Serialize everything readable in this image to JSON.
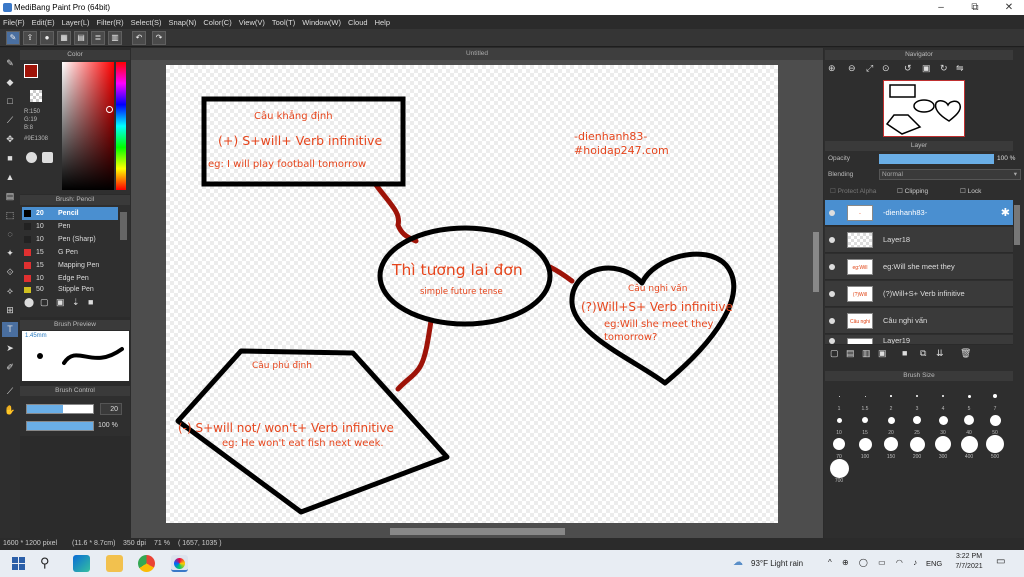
{
  "window": {
    "title": "MediBang Paint Pro (64bit)",
    "minimize": "–",
    "restore": "⧉",
    "close": "✕"
  },
  "menu": [
    "File(F)",
    "Edit(E)",
    "Layer(L)",
    "Filter(R)",
    "Select(S)",
    "Snap(N)",
    "Color(C)",
    "View(V)",
    "Tool(T)",
    "Window(W)",
    "Cloud",
    "Help"
  ],
  "color_panel": {
    "title": "Color",
    "r": "R:150",
    "g": "G:19",
    "b": "B:8",
    "hex": "#9E1308",
    "primary": "#9e1308"
  },
  "brush_panel": {
    "title": "Brush: Pencil",
    "items": [
      {
        "size": "20",
        "name": "Pencil",
        "color": "#4a8fd0",
        "selected": true
      },
      {
        "size": "10",
        "name": "Pen",
        "color": "#222222",
        "selected": false
      },
      {
        "size": "10",
        "name": "Pen (Sharp)",
        "color": "#222222",
        "selected": false
      },
      {
        "size": "15",
        "name": "G Pen",
        "color": "#e03030",
        "selected": false
      },
      {
        "size": "15",
        "name": "Mapping Pen",
        "color": "#e03030",
        "selected": false
      },
      {
        "size": "10",
        "name": "Edge Pen",
        "color": "#e03030",
        "selected": false
      },
      {
        "size": "50",
        "name": "Stipple Pen",
        "color": "#d0c020",
        "selected": false
      }
    ]
  },
  "brush_preview": {
    "title": "Brush Preview",
    "size": "1.45mm"
  },
  "brush_control": {
    "title": "Brush Control",
    "size": "20",
    "opacity": "100 %",
    "size_fraction": 0.55,
    "opacity_fraction": 1.0
  },
  "canvas": {
    "tab": "Untitled"
  },
  "diagram": {
    "center_title": "Thì tương lai đơn",
    "center_sub": "simple future tense",
    "box_title": "Câu khẳng định",
    "box_formula": "(+) S+will+ Verb infinitive",
    "box_example": "eg: I will play football tomorrow",
    "credit1": "-dienhanh83-",
    "credit2": "#hoidap247.com",
    "heart_title": "Câu nghi vấn",
    "heart_formula": "(?)Will+S+ Verb infinitive",
    "heart_example1": "eg:Will she meet they",
    "heart_example2": "tomorrow?",
    "pent_title": "Câu phủ định",
    "pent_formula": "(-) S+will not/ won't+ Verb infinitive",
    "pent_example": "eg: He won't eat fish next week."
  },
  "navigator": {
    "title": "Navigator"
  },
  "layer_panel": {
    "title": "Layer",
    "opacity_label": "Opacity",
    "opacity_value": "100 %",
    "opacity_fraction": 1.0,
    "blending_label": "Blending",
    "blending_value": "Normal",
    "protect_alpha": "Protect Alpha",
    "clipping": "Clipping",
    "lock": "Lock",
    "layers": [
      {
        "name": "-dienhanh83-",
        "thumb": "-dienhanh83-",
        "selected": true
      },
      {
        "name": "Layer18",
        "thumb": "",
        "selected": false
      },
      {
        "name": "eg:Will she meet they",
        "thumb": "eg:Will she",
        "selected": false
      },
      {
        "name": "(?)Will+S+ Verb infinitive",
        "thumb": "(?)Will",
        "selected": false
      },
      {
        "name": "Câu nghi vấn",
        "thumb": "Câu nghi",
        "selected": false
      },
      {
        "name": "Layer19",
        "thumb": "",
        "selected": false
      }
    ]
  },
  "brush_size_panel": {
    "title": "Brush Size",
    "sizes": [
      "1",
      "1.5",
      "2",
      "3",
      "4",
      "5",
      "7",
      "10",
      "15",
      "20",
      "25",
      "30",
      "40",
      "50",
      "70",
      "100",
      "150",
      "200",
      "300",
      "400",
      "500",
      "700"
    ]
  },
  "status": {
    "dims": "1600 * 1200 pixel",
    "cm": "(11.6 * 8.7cm)",
    "dpi": "350 dpi",
    "zoom": "71 %",
    "coords": "( 1657, 1035 )"
  },
  "taskbar": {
    "weather": "93°F  Light rain",
    "lang": "ENG",
    "time": "3:22 PM",
    "date": "7/7/2021"
  }
}
